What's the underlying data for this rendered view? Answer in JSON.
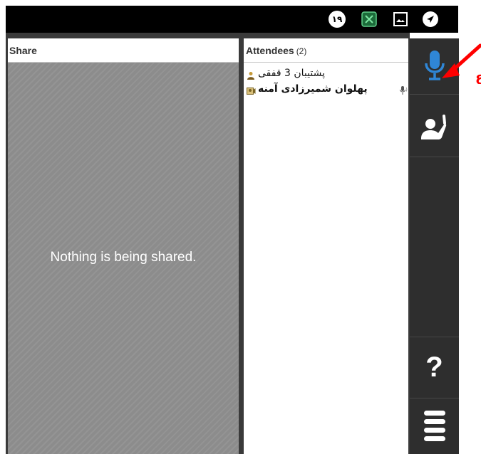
{
  "status_bar": {
    "badge_text": "١٩",
    "icons": [
      "notification-badge-icon",
      "app-icon",
      "gallery-icon",
      "navigation-icon"
    ]
  },
  "share": {
    "title": "Share",
    "empty_message": "Nothing is being shared."
  },
  "attendees": {
    "title": "Attendees",
    "count": "(2)",
    "items": [
      {
        "name": "پشتیبان 3 قفقی",
        "bold": false,
        "icon": "presenter-icon"
      },
      {
        "name": "پهلوان شمیرزادی آمنه",
        "bold": true,
        "icon": "user-webcam-icon",
        "speaking": true
      }
    ]
  },
  "sidebar": {
    "buttons": [
      "microphone-button",
      "raise-hand-button",
      "help-button",
      "menu-button"
    ],
    "help_label": "?",
    "accent_color": "#2f86d6"
  },
  "annotation": {
    "arrow_color": "#ff0000",
    "label": "ع"
  }
}
